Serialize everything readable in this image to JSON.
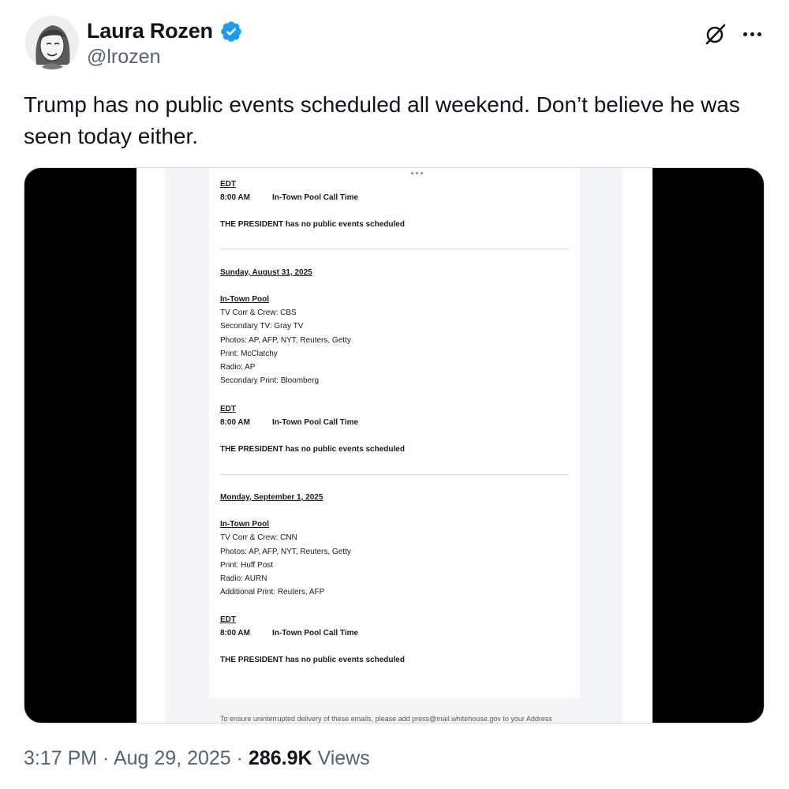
{
  "author": {
    "display_name": "Laura Rozen",
    "handle": "@lrozen",
    "verified_color": "#1d9bf0"
  },
  "icons": {
    "verified": "verified-badge-icon",
    "grok": "grok-icon",
    "more": "more-options-icon"
  },
  "tweet": {
    "text": "Trump has no public events scheduled all weekend. Don’t believe he was seen today either."
  },
  "screenshot": {
    "block1": {
      "tz": "EDT",
      "time": "8:00 AM",
      "event": "In-Town Pool Call Time",
      "note": "THE PRESIDENT has no public events scheduled"
    },
    "block2": {
      "date": "Sunday, August 31, 2025",
      "pool_title": "In-Town Pool",
      "pool_lines": [
        "TV Corr & Crew: CBS",
        "Secondary TV: Gray TV",
        "Photos: AP, AFP, NYT, Reuters, Getty",
        "Print: McClatchy",
        "Radio: AP",
        "Secondary Print: Bloomberg"
      ],
      "tz": "EDT",
      "time": "8:00 AM",
      "event": "In-Town Pool Call Time",
      "note": "THE PRESIDENT has no public events scheduled"
    },
    "block3": {
      "date": "Monday, September 1, 2025",
      "pool_title": "In-Town Pool",
      "pool_lines": [
        "TV Corr & Crew: CNN",
        "Photos: AP, AFP, NYT, Reuters, Getty",
        "Print: Huff Post",
        "Radio: AURN",
        "Additional Print: Reuters, AFP"
      ],
      "tz": "EDT",
      "time": "8:00 AM",
      "event": "In-Town Pool Call Time",
      "note": "THE PRESIDENT has no public events scheduled"
    },
    "footer_partial": "To ensure uninterrupted delivery of these emails, please add press@mail.whitehouse.gov to your Address"
  },
  "meta": {
    "time": "3:17 PM",
    "sep1": " · ",
    "date": "Aug 29, 2025",
    "sep2": " · ",
    "views_count": "286.9K",
    "views_label": " Views"
  }
}
